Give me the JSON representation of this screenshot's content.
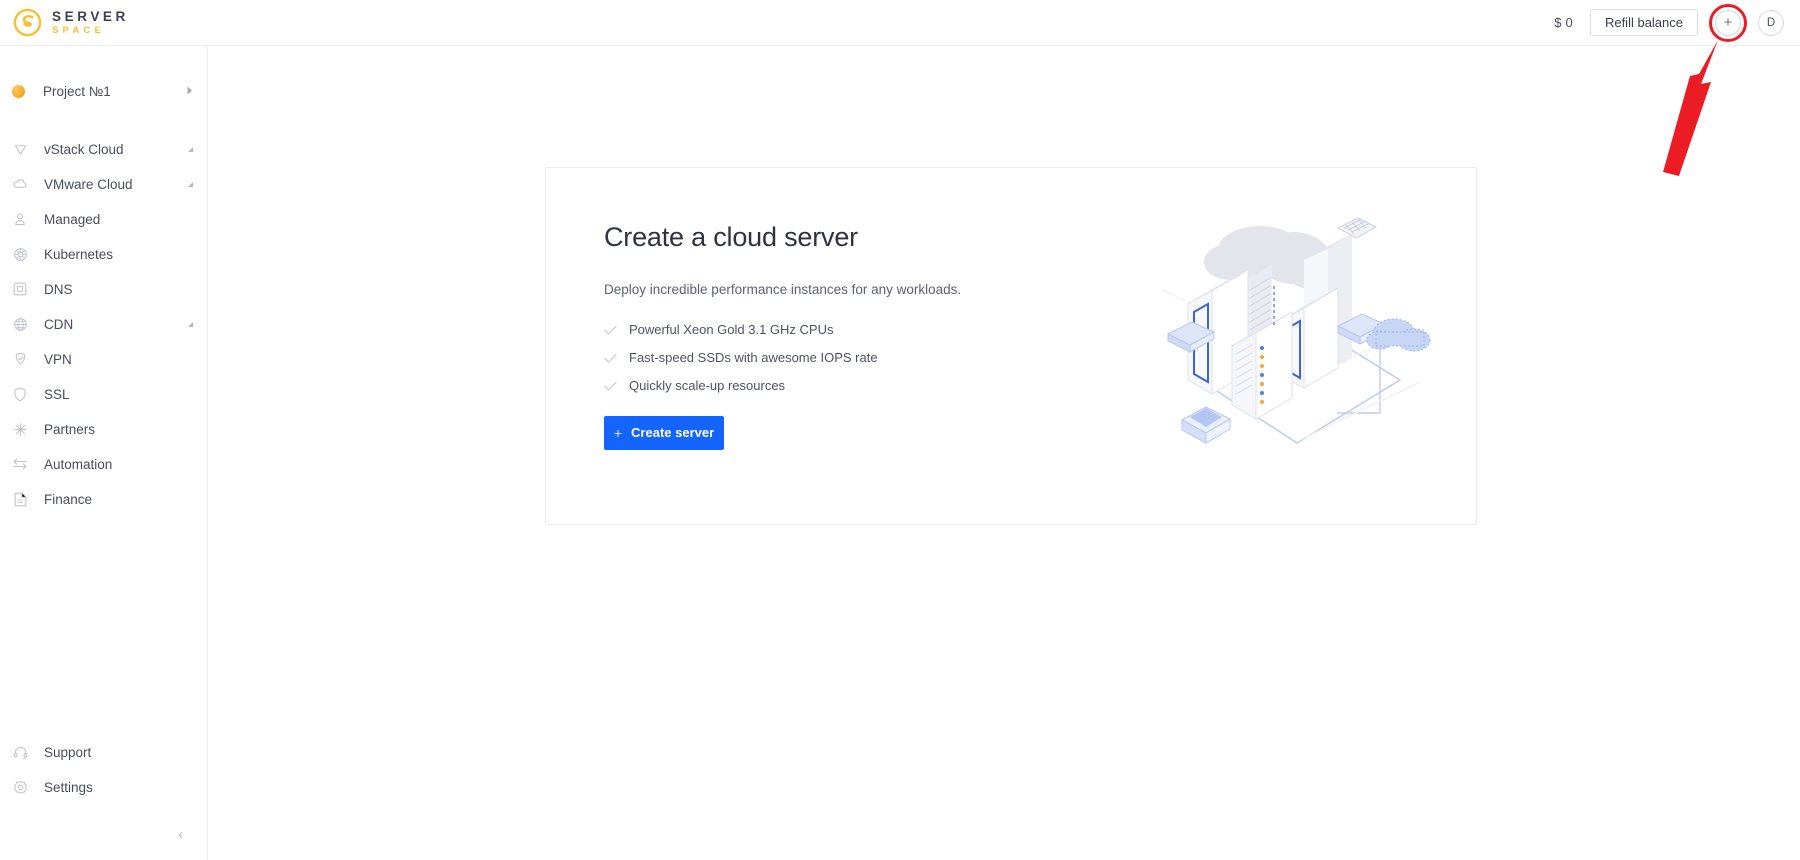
{
  "header": {
    "logo": {
      "mark_icon": "serverspace-s-logo-icon",
      "primary_text": "SERVER",
      "secondary_text": "SPACE",
      "primary_color": "#3d4050",
      "secondary_color": "#f7c02e"
    },
    "balance": "$ 0",
    "refill_label": "Refill balance",
    "add_button_glyph": "+",
    "avatar_initial": "D"
  },
  "annotation": {
    "highlight_color": "#ec1c24",
    "target": "add-button",
    "arrow_direction": "up-right"
  },
  "sidebar": {
    "project": {
      "label": "Project №1",
      "dot_color": "#f6a623",
      "chevron": "▶"
    },
    "items": [
      {
        "label": "vStack Cloud",
        "icon": "vstack-icon",
        "expandable": true
      },
      {
        "label": "VMware Cloud",
        "icon": "cloud-icon",
        "expandable": true
      },
      {
        "label": "Managed",
        "icon": "user-icon",
        "expandable": false
      },
      {
        "label": "Kubernetes",
        "icon": "kubernetes-icon",
        "expandable": false
      },
      {
        "label": "DNS",
        "icon": "dns-square-icon",
        "expandable": false
      },
      {
        "label": "CDN",
        "icon": "globe-icon",
        "expandable": true
      },
      {
        "label": "VPN",
        "icon": "shield-check-icon",
        "expandable": false
      },
      {
        "label": "SSL",
        "icon": "shield-icon",
        "expandable": false
      },
      {
        "label": "Partners",
        "icon": "asterisk-icon",
        "expandable": false
      },
      {
        "label": "Automation",
        "icon": "arrows-swap-icon",
        "expandable": false
      },
      {
        "label": "Finance",
        "icon": "document-icon",
        "expandable": false
      }
    ],
    "bottom_items": [
      {
        "label": "Support",
        "icon": "headset-icon"
      },
      {
        "label": "Settings",
        "icon": "gear-icon"
      }
    ],
    "collapse_glyph": "‹"
  },
  "main": {
    "card": {
      "title": "Create a cloud server",
      "subtitle": "Deploy incredible performance instances for any workloads.",
      "features": [
        "Powerful Xeon Gold 3.1 GHz CPUs",
        "Fast-speed SSDs with awesome IOPS rate",
        "Quickly scale-up resources"
      ],
      "cta_label": "Create server",
      "cta_plus": "+",
      "cta_color": "#1464ff",
      "illustration": "isometric-datacenter-illustration"
    }
  }
}
